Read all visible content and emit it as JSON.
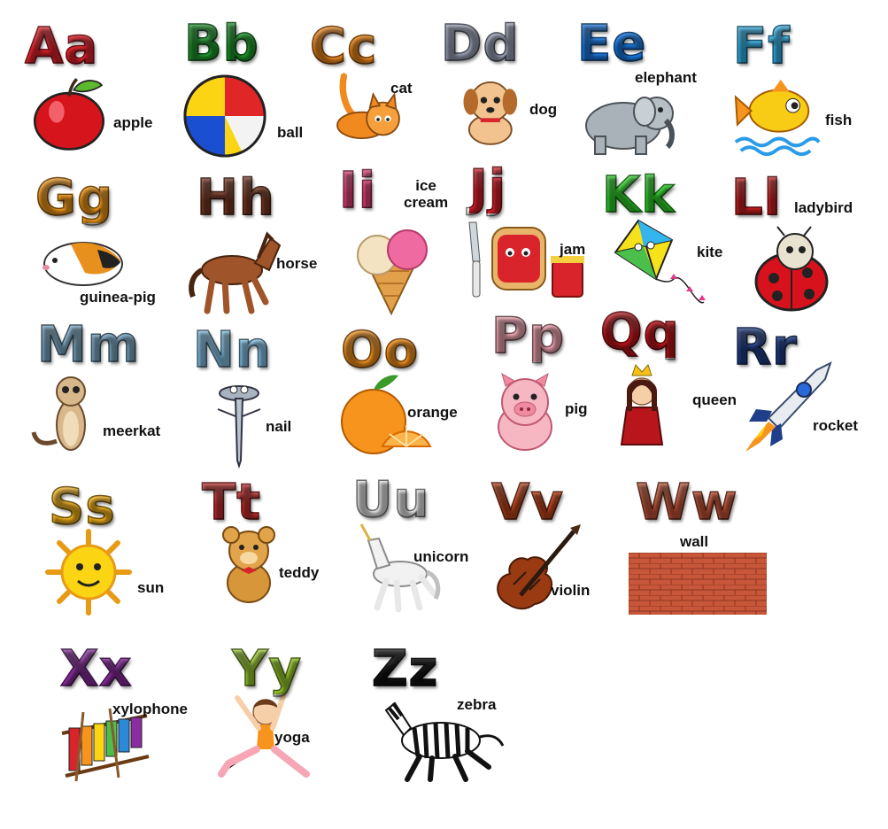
{
  "alphabet": [
    {
      "key": "a",
      "letters": "Aa",
      "word": "apple",
      "color": "#e8232e",
      "icon": "apple-icon"
    },
    {
      "key": "b",
      "letters": "Bb",
      "word": "ball",
      "color": "#1f9a2c",
      "icon": "ball-icon"
    },
    {
      "key": "c",
      "letters": "Cc",
      "word": "cat",
      "color": "#f08a1f",
      "icon": "cat-icon"
    },
    {
      "key": "d",
      "letters": "Dd",
      "word": "dog",
      "color": "#9ea4ba",
      "icon": "dog-icon"
    },
    {
      "key": "e",
      "letters": "Ee",
      "word": "elephant",
      "color": "#1a7de8",
      "icon": "elephant-icon"
    },
    {
      "key": "f",
      "letters": "Ff",
      "word": "fish",
      "color": "#33b7f0",
      "icon": "fish-icon"
    },
    {
      "key": "g",
      "letters": "Gg",
      "word": "guinea-pig",
      "color": "#f39a1b",
      "icon": "guinea-pig-icon"
    },
    {
      "key": "h",
      "letters": "Hh",
      "word": "horse",
      "color": "#7a3a23",
      "icon": "horse-icon"
    },
    {
      "key": "i",
      "letters": "Ii",
      "word": "ice\ncream",
      "color": "#e8447c",
      "icon": "ice-cream-icon"
    },
    {
      "key": "j",
      "letters": "Jj",
      "word": "jam",
      "color": "#d81f2a",
      "icon": "jam-icon"
    },
    {
      "key": "k",
      "letters": "Kk",
      "word": "kite",
      "color": "#2fd62a",
      "icon": "kite-icon"
    },
    {
      "key": "l",
      "letters": "Ll",
      "word": "ladybird",
      "color": "#cc1f22",
      "icon": "ladybird-icon"
    },
    {
      "key": "m",
      "letters": "Mm",
      "word": "meerkat",
      "color": "#7faecb",
      "icon": "meerkat-icon"
    },
    {
      "key": "n",
      "letters": "Nn",
      "word": "nail",
      "color": "#8ac9ee",
      "icon": "nail-icon"
    },
    {
      "key": "o",
      "letters": "Oo",
      "word": "orange",
      "color": "#f7941d",
      "icon": "orange-icon"
    },
    {
      "key": "p",
      "letters": "Pp",
      "word": "pig",
      "color": "#f4a6b4",
      "icon": "pig-icon"
    },
    {
      "key": "q",
      "letters": "Qq",
      "word": "queen",
      "color": "#c0161c",
      "icon": "queen-icon"
    },
    {
      "key": "r",
      "letters": "Rr",
      "word": "rocket",
      "color": "#1f3f8a",
      "icon": "rocket-icon"
    },
    {
      "key": "s",
      "letters": "Ss",
      "word": "sun",
      "color": "#f6b51b",
      "icon": "sun-icon"
    },
    {
      "key": "t",
      "letters": "Tt",
      "word": "teddy",
      "color": "#c9302e",
      "icon": "teddy-icon"
    },
    {
      "key": "u",
      "letters": "Uu",
      "word": "unicorn",
      "color": "#ebebeb",
      "icon": "unicorn-icon"
    },
    {
      "key": "v",
      "letters": "Vv",
      "word": "violin",
      "color": "#c0461e",
      "icon": "violin-icon"
    },
    {
      "key": "w",
      "letters": "Ww",
      "word": "wall",
      "color": "#c8573a",
      "icon": "brick-wall-icon"
    },
    {
      "key": "x",
      "letters": "Xx",
      "word": "xylophone",
      "color": "#8a2da0",
      "icon": "xylophone-icon"
    },
    {
      "key": "y",
      "letters": "Yy",
      "word": "yoga",
      "color": "#9ccf2e",
      "icon": "yoga-icon"
    },
    {
      "key": "z",
      "letters": "Zz",
      "word": "zebra",
      "color": "#111111",
      "icon": "zebra-icon"
    }
  ]
}
